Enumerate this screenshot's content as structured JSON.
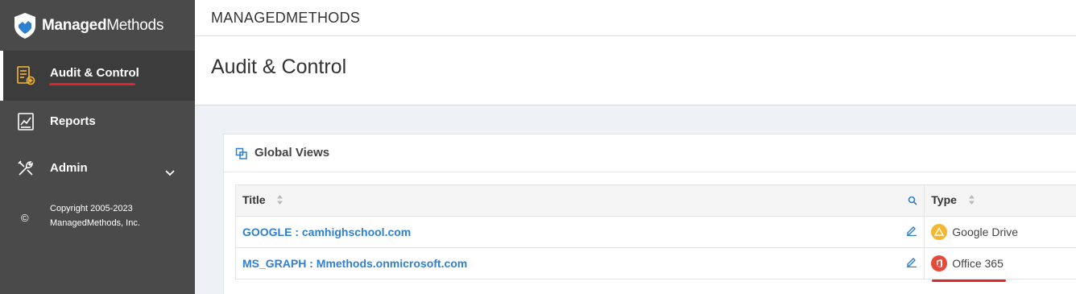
{
  "sidebar": {
    "logo": {
      "part1": "Managed",
      "part2": "Methods"
    },
    "items": [
      {
        "label": "Audit & Control",
        "icon": "audit-icon"
      },
      {
        "label": "Reports",
        "icon": "reports-icon"
      },
      {
        "label": "Admin",
        "icon": "tools-icon"
      }
    ],
    "copyright_symbol": "©",
    "copyright_line1": "Copyright 2005-2023",
    "copyright_line2": "ManagedMethods, Inc."
  },
  "header": {
    "brand": "MANAGEDMETHODS",
    "page_title": "Audit & Control"
  },
  "panel": {
    "title": "Global Views",
    "columns": [
      "Title",
      "Type"
    ],
    "rows": [
      {
        "title": "GOOGLE : camhighschool.com",
        "type": "Google Drive",
        "type_icon": "google-drive-icon"
      },
      {
        "title": "MS_GRAPH : Mmethods.onmicrosoft.com",
        "type": "Office 365",
        "type_icon": "office365-icon"
      }
    ]
  },
  "colors": {
    "sidebar": "#4a4a4a",
    "link": "#2f7fd1",
    "highlight": "#e0242b",
    "accent_icon": "#f5b733"
  }
}
